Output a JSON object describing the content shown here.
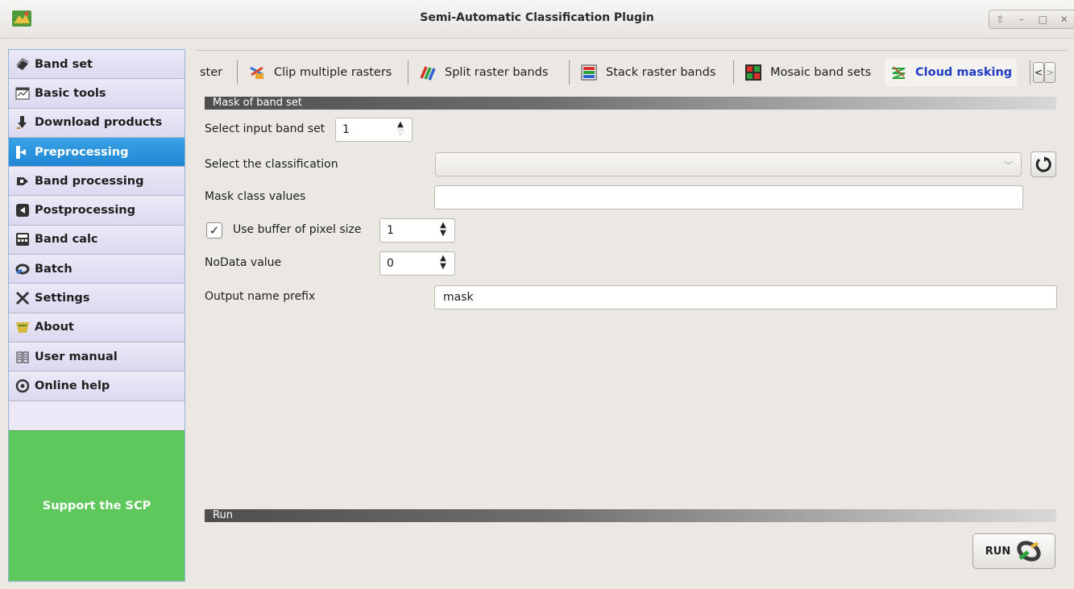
{
  "window": {
    "title": "Semi-Automatic Classification Plugin",
    "controls": [
      "⇧",
      "–",
      "□",
      "✕"
    ]
  },
  "sidebar": {
    "items": [
      {
        "label": "Band set",
        "icon": "band-set-icon"
      },
      {
        "label": "Basic tools",
        "icon": "basic-tools-icon"
      },
      {
        "label": "Download products",
        "icon": "download-icon"
      },
      {
        "label": "Preprocessing",
        "icon": "preprocessing-icon",
        "active": true
      },
      {
        "label": "Band processing",
        "icon": "band-processing-icon"
      },
      {
        "label": "Postprocessing",
        "icon": "postprocessing-icon"
      },
      {
        "label": "Band calc",
        "icon": "band-calc-icon"
      },
      {
        "label": "Batch",
        "icon": "batch-icon"
      },
      {
        "label": "Settings",
        "icon": "settings-icon"
      },
      {
        "label": "About",
        "icon": "about-icon"
      },
      {
        "label": "User manual",
        "icon": "user-manual-icon"
      },
      {
        "label": "Online help",
        "icon": "online-help-icon"
      }
    ],
    "support_label": "Support the SCP"
  },
  "tabs": {
    "items": [
      {
        "label": "ster"
      },
      {
        "label": "Clip multiple rasters",
        "icon": "clip-icon"
      },
      {
        "label": "Split raster bands",
        "icon": "split-icon"
      },
      {
        "label": "Stack raster bands",
        "icon": "stack-icon"
      },
      {
        "label": "Mosaic band sets",
        "icon": "mosaic-icon"
      },
      {
        "label": "Cloud masking",
        "icon": "cloud-masking-icon",
        "active": true
      }
    ],
    "scroll_left": "<",
    "scroll_right": ">"
  },
  "mask": {
    "section_title": "Mask of band set",
    "input_band_set_label": "Select input band set",
    "input_band_set_value": "1",
    "classification_label": "Select the classification",
    "classification_value": "",
    "class_values_label": "Mask class values",
    "class_values_value": "",
    "buffer_label": "Use buffer of pixel size",
    "buffer_checked": true,
    "buffer_value": "1",
    "nodata_label": "NoData value",
    "nodata_value": "0",
    "prefix_label": "Output name prefix",
    "prefix_value": "mask"
  },
  "run": {
    "section_title": "Run",
    "button_label": "RUN"
  },
  "colors": {
    "active_sidebar": "#2b95de",
    "support_bg": "#5fc85c",
    "active_tab_text": "#1d3bc3"
  }
}
